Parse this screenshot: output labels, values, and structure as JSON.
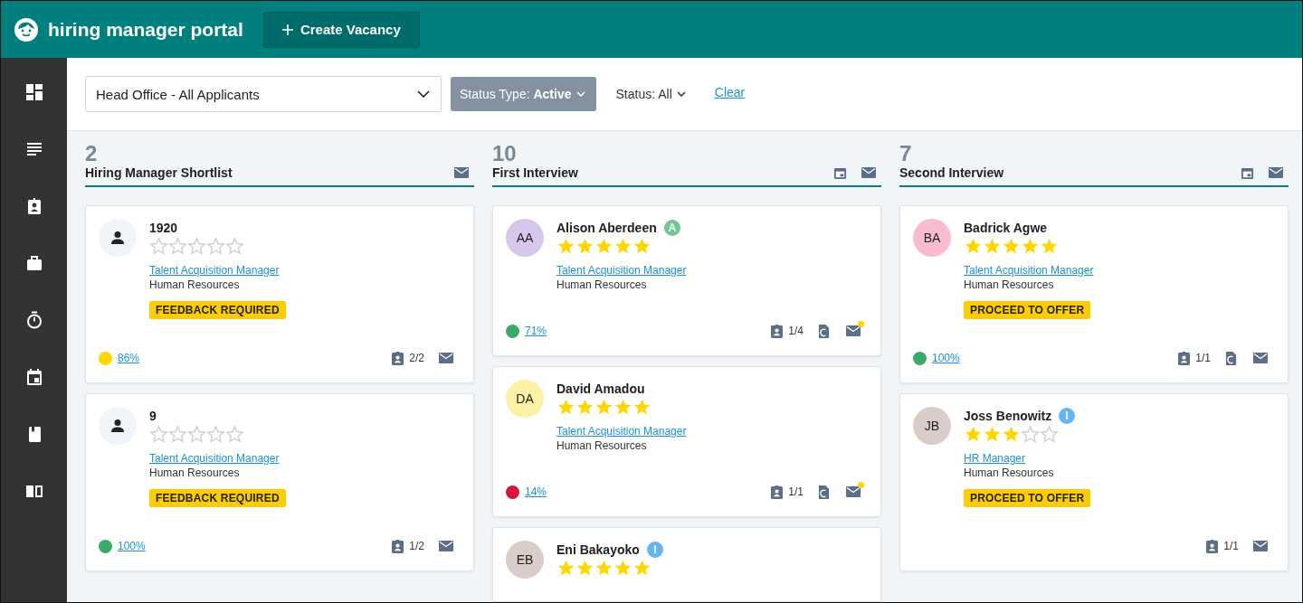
{
  "header": {
    "title": "hiring manager portal",
    "create_button": "Create Vacancy"
  },
  "sidebar": {
    "items": [
      {
        "kind": "dashboard"
      },
      {
        "kind": "list"
      },
      {
        "kind": "badge"
      },
      {
        "kind": "briefcase"
      },
      {
        "kind": "stopwatch"
      },
      {
        "kind": "calendar"
      },
      {
        "kind": "book"
      },
      {
        "kind": "open-book"
      }
    ]
  },
  "filters": {
    "location": "Head Office - All Applicants",
    "status_type": "Status Type: **Active**",
    "status": "Status: All",
    "clear": "Clear"
  },
  "columns": [
    {
      "count": "2",
      "title": "Hiring Manager Shortlist",
      "icons": [
        {
          "kind": "mail"
        }
      ],
      "cards": [
        {
          "name": "1920",
          "stars": 0,
          "role": "Talent Acquisition Manager",
          "department": "Human Resources",
          "tag": "FEEDBACK REQUIRED",
          "score": {
            "text": "86%",
            "color": "#ffd600"
          },
          "interviews": "2/2",
          "document": false,
          "mail_unread": false
        },
        {
          "name": "9",
          "stars": 0,
          "role": "Talent Acquisition Manager",
          "department": "Human Resources",
          "tag": "FEEDBACK REQUIRED",
          "score": {
            "text": "100%",
            "color": "#3aaa6a"
          },
          "interviews": "1/2",
          "document": false,
          "mail_unread": false
        }
      ]
    },
    {
      "count": "10",
      "title": "First Interview",
      "icons": [
        {
          "kind": "calendar"
        },
        {
          "kind": "mail"
        }
      ],
      "cards": [
        {
          "avatar": {
            "initials": "AA",
            "color": "#d5c8ea"
          },
          "name": "Alison Aberdeen",
          "badge": {
            "letter": "A",
            "color": "#74c795"
          },
          "stars": 5,
          "role": "Talent Acquisition Manager",
          "department": "Human Resources",
          "score": {
            "text": "71%",
            "color": "#3aaa6a"
          },
          "interviews": "1/4",
          "document": true,
          "mail_unread": true
        },
        {
          "avatar": {
            "initials": "DA",
            "color": "#fcf2a6"
          },
          "name": "David Amadou",
          "stars": 5,
          "role": "Talent Acquisition Manager",
          "department": "Human Resources",
          "score": {
            "text": "14%",
            "color": "#d5153a"
          },
          "interviews": "1/1",
          "document": true,
          "mail_unread": true
        },
        {
          "avatar": {
            "initials": "EB",
            "color": "#d9cdca"
          },
          "name": "Eni Bakayoko",
          "badge": {
            "letter": "I",
            "color": "#64b5f6"
          },
          "stars": 5
        }
      ]
    },
    {
      "count": "7",
      "title": "Second Interview",
      "icons": [
        {
          "kind": "calendar"
        },
        {
          "kind": "mail"
        }
      ],
      "cards": [
        {
          "avatar": {
            "initials": "BA",
            "color": "#f8bbd0"
          },
          "name": "Badrick Agwe",
          "stars": 5,
          "role": "Talent Acquisition Manager",
          "department": "Human Resources",
          "tag": "PROCEED TO OFFER",
          "score": {
            "text": "100%",
            "color": "#3aaa6a"
          },
          "interviews": "1/1",
          "document": true,
          "mail_unread": false
        },
        {
          "avatar": {
            "initials": "JB",
            "color": "#d9cdca"
          },
          "name": "Joss Benowitz",
          "badge": {
            "letter": "I",
            "color": "#64b5f6"
          },
          "stars": 3,
          "role": "HR Manager",
          "department": "Human Resources",
          "tag": "PROCEED TO OFFER",
          "interviews": "1/1",
          "document": false,
          "mail_unread": false
        }
      ]
    }
  ]
}
